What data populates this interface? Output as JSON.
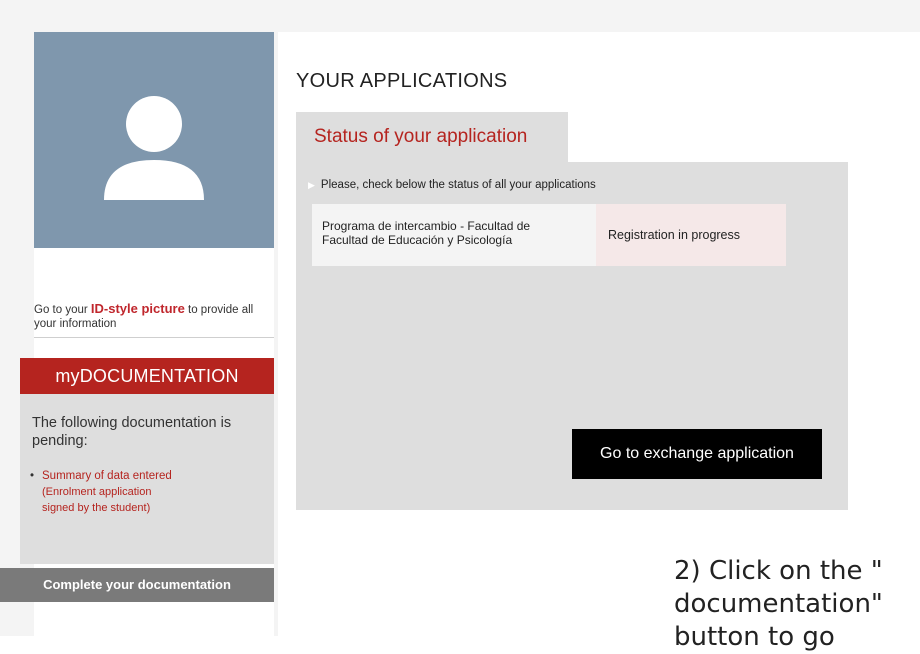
{
  "sidebar": {
    "id_hint_prefix": "Go to your ",
    "id_hint_link": "ID-style picture",
    "id_hint_suffix": " to provide all your information",
    "doc_header": "myDOCUMENTATION",
    "doc_intro": "The following documentation is pending:",
    "pending_items": [
      {
        "title": "Summary of data entered",
        "subtitle_line1": "(Enrolment application",
        "subtitle_line2": "signed by the student)"
      }
    ],
    "complete_button": "Complete your documentation"
  },
  "main": {
    "section_title": "YOUR APPLICATIONS",
    "tab_label": "Status of your application",
    "status_note": "Please, check below the status of all your applications",
    "applications": [
      {
        "program_line1": "Programa de intercambio - Facultad de",
        "program_line2": "Facultad de Educación y Psicología",
        "status": "Registration in progress"
      }
    ],
    "go_button": "Go to exchange application"
  },
  "annotation": {
    "line1": "2) Click on the \"",
    "line2": "documentation\"",
    "line3": "button to go"
  },
  "colors": {
    "accent_red": "#b5241f",
    "avatar_bg": "#7f97ad",
    "panel_gray": "#dedede",
    "button_black": "#000000",
    "button_gray": "#7a7a7a"
  },
  "icons": {
    "avatar": "user-silhouette-icon",
    "note_arrow": "triangle-right-icon"
  }
}
